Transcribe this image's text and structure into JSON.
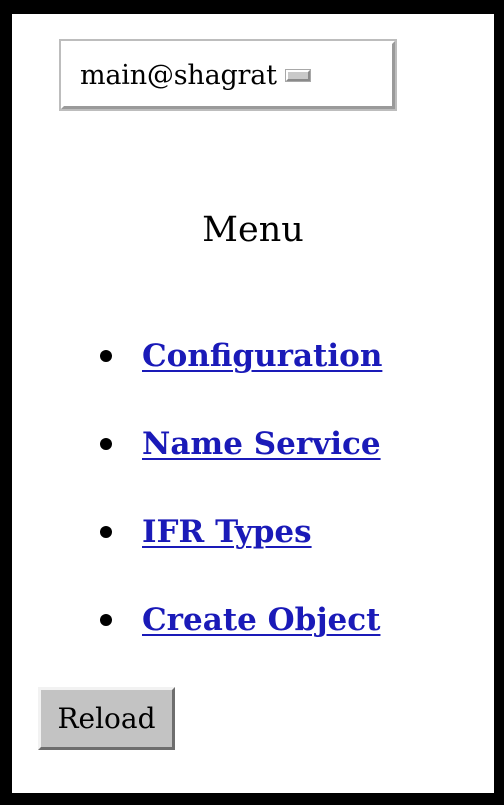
{
  "server_select": {
    "selected_value": "main@shagrat"
  },
  "menu": {
    "title": "Menu",
    "items": [
      {
        "label": "Configuration"
      },
      {
        "label": "Name Service"
      },
      {
        "label": "IFR Types"
      },
      {
        "label": "Create Object"
      }
    ]
  },
  "reload_button": {
    "label": "Reload"
  },
  "colors": {
    "link": "#1a1ab8",
    "button_face": "#c3c3c3",
    "border": "#000000"
  }
}
